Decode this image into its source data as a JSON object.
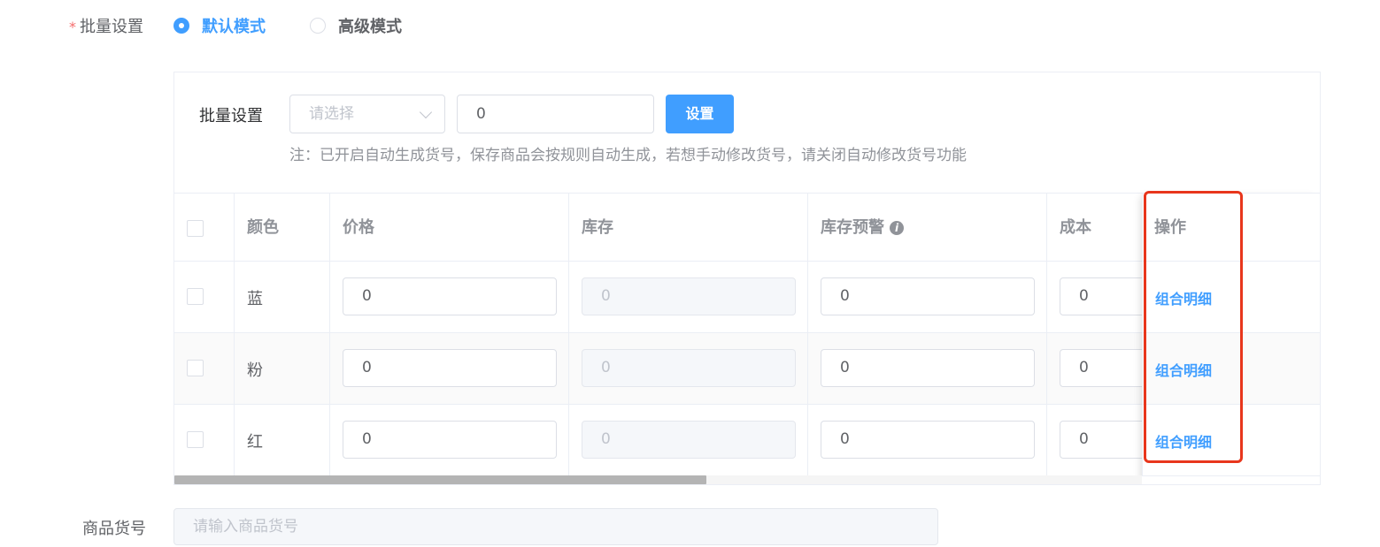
{
  "mode": {
    "label": "批量设置",
    "required_mark": "*",
    "options": [
      {
        "label": "默认模式",
        "checked": true
      },
      {
        "label": "高级模式",
        "checked": false
      }
    ]
  },
  "batch": {
    "label": "批量设置",
    "select_placeholder": "请选择",
    "input_value": "0",
    "set_button": "设置",
    "note": "注：已开启自动生成货号，保存商品会按规则自动生成，若想手动修改货号，请关闭自动修改货号功能"
  },
  "table": {
    "headers": {
      "color": "颜色",
      "price": "价格",
      "stock": "库存",
      "stock_warning": "库存预警",
      "cost": "成本",
      "action": "操作"
    },
    "rows": [
      {
        "color": "蓝",
        "price": "0",
        "stock": "0",
        "stock_warning": "0",
        "cost": "0",
        "action": "组合明细"
      },
      {
        "color": "粉",
        "price": "0",
        "stock": "0",
        "stock_warning": "0",
        "cost": "0",
        "action": "组合明细"
      },
      {
        "color": "红",
        "price": "0",
        "stock": "0",
        "stock_warning": "0",
        "cost": "0",
        "action": "组合明细"
      }
    ],
    "horizontal_scroll_fraction": 0.55
  },
  "sku": {
    "label": "商品货号",
    "placeholder": "请输入商品货号"
  },
  "colors": {
    "primary": "#409eff",
    "highlight_box": "#e8361c",
    "required": "#f56c6c"
  },
  "icons": [
    "info-icon",
    "chevron-down-icon"
  ]
}
